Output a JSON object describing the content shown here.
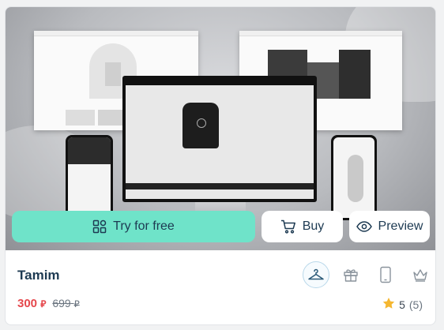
{
  "template": {
    "name": "Tamim",
    "price": {
      "current": "300",
      "original": "699",
      "currency_symbol": "⃁"
    },
    "rating": {
      "value": "5",
      "count": "(5)"
    }
  },
  "actions": {
    "try_label": "Try for free",
    "buy_label": "Buy",
    "preview_label": "Preview"
  },
  "categories": [
    "clothing-hanger-icon",
    "gift-icon",
    "mobile-icon",
    "crown-icon"
  ],
  "colors": {
    "try_button": "#6fe3c9",
    "title": "#1d3a52",
    "price": "#e5484d",
    "star": "#f5b731"
  }
}
